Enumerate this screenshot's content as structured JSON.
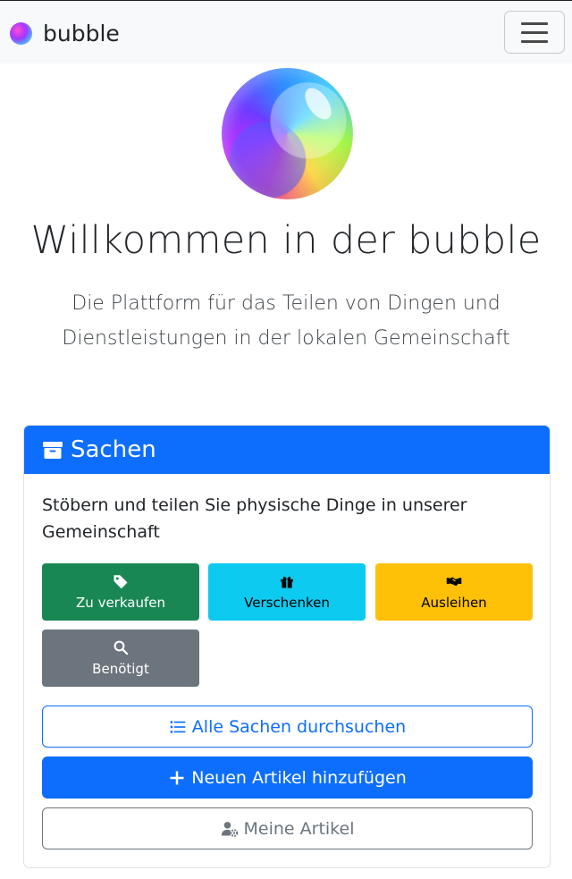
{
  "navbar": {
    "brand_text": "bubble",
    "logo_icon": "bubble-logo-icon",
    "menu_icon": "hamburger-menu-icon"
  },
  "hero": {
    "logo_icon": "bubble-logo-icon",
    "title": "Willkommen in der bubble",
    "subtitle": "Die Plattform für das Teilen von Dingen und Dienstleistungen in der lokalen Gemeinschaft"
  },
  "card": {
    "header_icon": "box-icon",
    "header_title": "Sachen",
    "description": "Stöbern und teilen Sie physische Dinge in unserer Gemeinschaft",
    "categories": [
      {
        "label": "Zu verkaufen",
        "icon": "tag-icon",
        "color": "#198754"
      },
      {
        "label": "Verschenken",
        "icon": "gift-icon",
        "color": "#0dcaf0"
      },
      {
        "label": "Ausleihen",
        "icon": "handshake-icon",
        "color": "#ffc107"
      },
      {
        "label": "Benötigt",
        "icon": "search-icon",
        "color": "#6c757d"
      }
    ],
    "buttons": {
      "browse_all": {
        "label": "Alle Sachen durchsuchen",
        "icon": "list-icon"
      },
      "add_new": {
        "label": "Neuen Artikel hinzufügen",
        "icon": "plus-icon"
      },
      "my_items": {
        "label": "Meine Artikel",
        "icon": "user-gear-icon"
      }
    }
  },
  "colors": {
    "primary": "#0d6efd",
    "success": "#198754",
    "info": "#0dcaf0",
    "warning": "#ffc107",
    "secondary": "#6c757d"
  }
}
